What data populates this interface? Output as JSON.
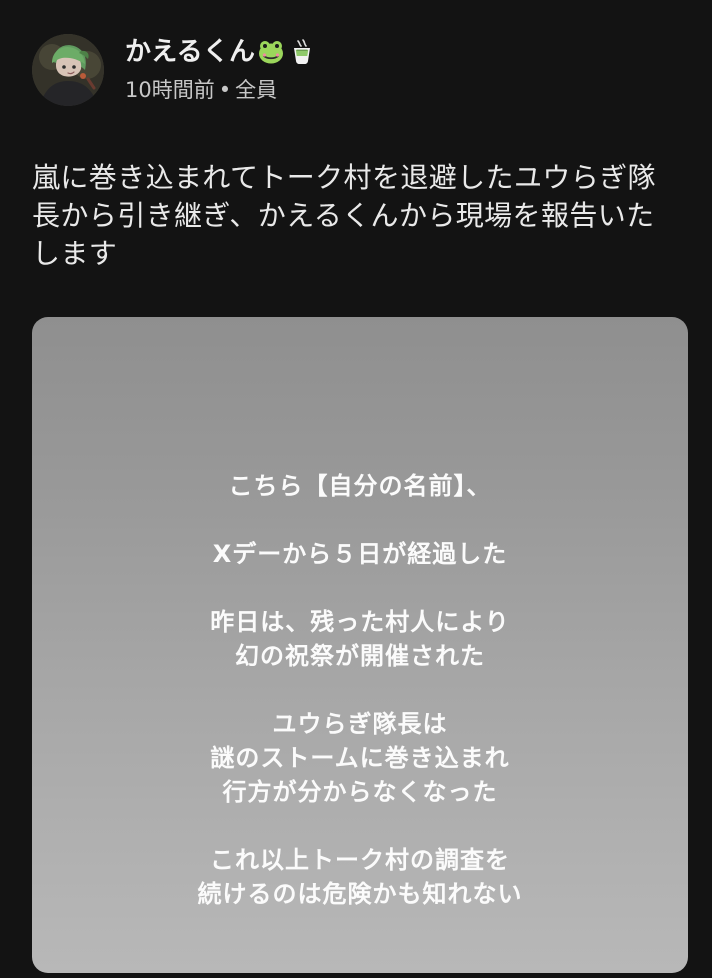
{
  "author": {
    "name": "かえるくん",
    "decoration_icons": [
      "frog-icon",
      "teacup-icon"
    ],
    "time": "10時間前",
    "separator": "•",
    "audience": "全員",
    "avatar_icon": "avatar-portrait"
  },
  "post": {
    "text": "嵐に巻き込まれてトーク村を退避したユウらぎ隊長から引き継ぎ、かえるくんから現場を報告いたします"
  },
  "story_card": {
    "paragraphs": [
      [
        "こちら【自分の名前】、"
      ],
      [
        "Xデーから５日が経過した"
      ],
      [
        "昨日は、残った村人により",
        "幻の祝祭が開催された"
      ],
      [
        "ユウらぎ隊長は",
        "謎のストームに巻き込まれ",
        "行方が分からなくなった"
      ],
      [
        "これ以上トーク村の調査を",
        "続けるのは危険かも知れない"
      ]
    ]
  },
  "colors": {
    "background": "#131313",
    "text": "#e9e9e9",
    "secondary_text": "#c8c8c8",
    "card_top": "#8f8f8f",
    "card_bottom": "#b8b8b8",
    "card_text": "#fbfbfb",
    "frog_icon": "#9bd65b",
    "avatar_hair": "#5f9a5f"
  }
}
